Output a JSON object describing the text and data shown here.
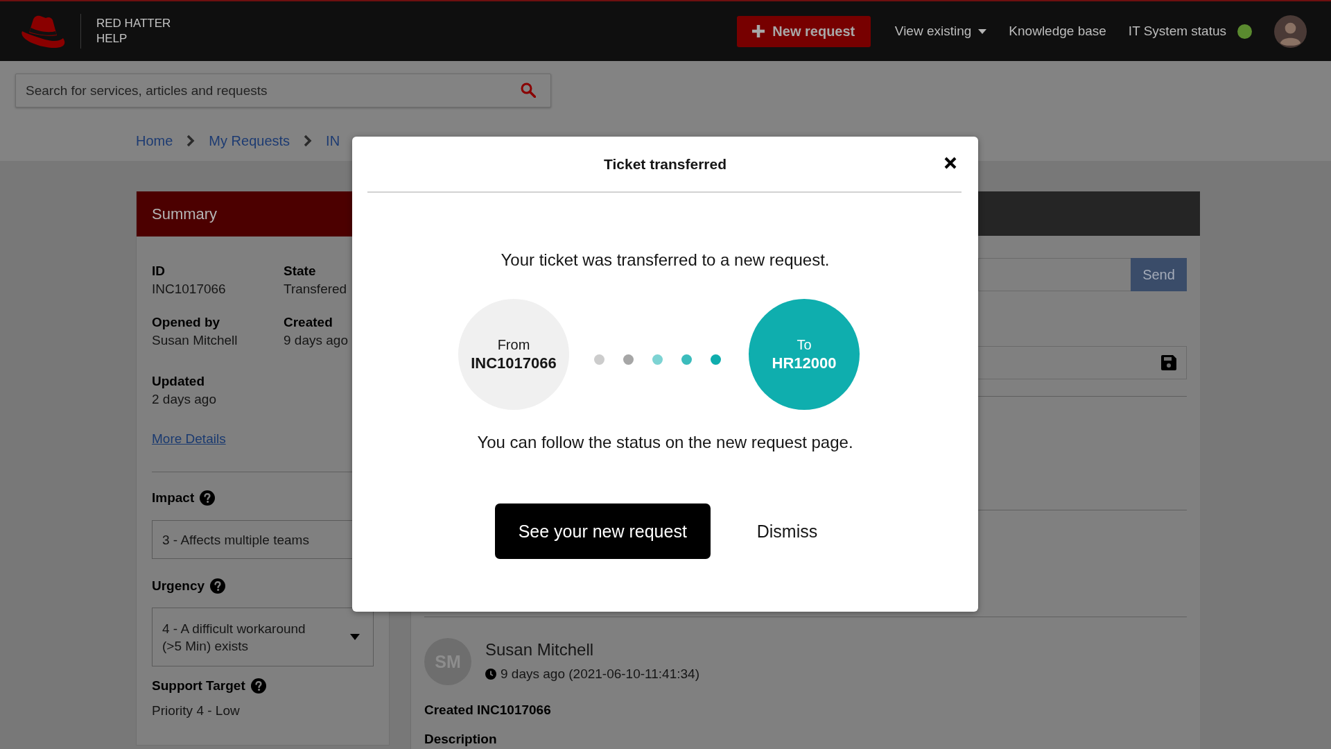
{
  "header": {
    "brand_lines": [
      "RED HATTER",
      "HELP"
    ],
    "new_request": "New request",
    "nav": [
      {
        "label": "View existing",
        "kind": "dropdown"
      },
      {
        "label": "Knowledge base",
        "kind": "link"
      },
      {
        "label": "IT System status",
        "kind": "status"
      }
    ]
  },
  "search": {
    "placeholder": "Search for services, articles and requests"
  },
  "breadcrumb": [
    "Home",
    "My Requests",
    "IN"
  ],
  "summary": {
    "title": "Summary",
    "fields": [
      {
        "label": "ID",
        "value": "INC1017066"
      },
      {
        "label": "State",
        "value": "Transfered"
      },
      {
        "label": "Opened by",
        "value": "Susan Mitchell"
      },
      {
        "label": "Created",
        "value": "9 days ago"
      },
      {
        "label": "Updated",
        "value": "2 days ago"
      }
    ],
    "link": "More Details",
    "impact": {
      "label": "Impact",
      "value": "3 - Affects multiple teams"
    },
    "urgency": {
      "label": "Urgency",
      "value": "4 - A difficult workaround (>5 Min) exists"
    },
    "support_target": {
      "label": "Support Target",
      "value": "Priority 4 - Low"
    }
  },
  "comment": {
    "send_button": "Send"
  },
  "activity": {
    "initials": "SM",
    "author": "Susan Mitchell",
    "time": "9 days ago (2021-06-10-11:41:34)",
    "title": "Created INC1017066",
    "section": "Description"
  },
  "modal": {
    "title": "Ticket transferred",
    "message": "Your ticket was transferred to a new request.",
    "from": {
      "label": "From",
      "ticket": "INC1017066"
    },
    "to": {
      "label": "To",
      "ticket": "HR12000"
    },
    "dots": [
      {
        "color": "#cccccc"
      },
      {
        "color": "#a6a6a6"
      },
      {
        "color": "#7dd3d3"
      },
      {
        "color": "#3bbcbc"
      },
      {
        "color": "#0fadad"
      }
    ],
    "note": "You can follow the status on the new request page.",
    "primary_button": "See your new request",
    "secondary_button": "Dismiss"
  }
}
